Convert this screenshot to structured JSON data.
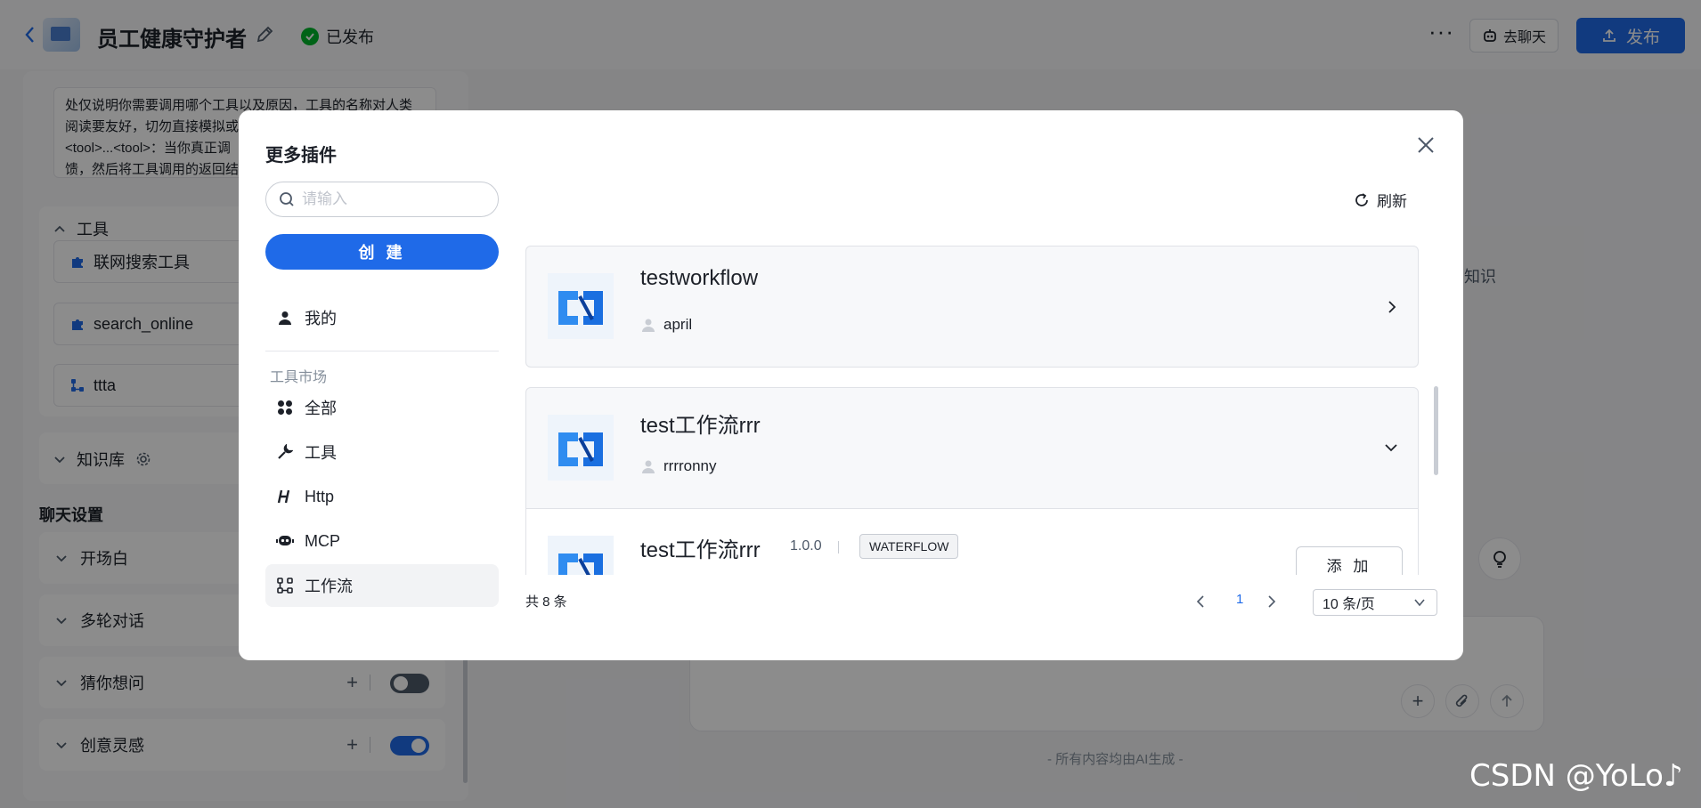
{
  "app": {
    "title": "员工健康守护者",
    "status": "已发布",
    "chat_button": "去聊天",
    "publish_button": "发布"
  },
  "left_panel": {
    "prompt_lines": [
      "处仅说明你需要调用哪个工具以及原因，工具的名称对人类",
      "阅读要友好，切勿直接模拟或",
      "<tool>...<tool>：当你真正调",
      "馈，然后将工具调用的返回结"
    ],
    "tools_section": "工具",
    "tools": [
      "联网搜索工具",
      "search_online",
      "ttta"
    ],
    "knowledge_section": "知识库",
    "chat_settings_title": "聊天设置",
    "settings": [
      {
        "label": "开场白"
      },
      {
        "label": "多轮对话"
      },
      {
        "label": "猜你想问",
        "toggle": false
      },
      {
        "label": "创意灵感",
        "toggle": true
      }
    ]
  },
  "right_area": {
    "knowledge_text": "知识",
    "ai_note": "- 所有内容均由AI生成 -"
  },
  "watermark": "CSDN @YoLo♪",
  "modal": {
    "title": "更多插件",
    "search_placeholder": "请输入",
    "create_button": "创 建",
    "nav_mine": "我的",
    "nav_group": "工具市场",
    "nav_items": [
      "全部",
      "工具",
      "Http",
      "MCP",
      "工作流"
    ],
    "refresh_label": "刷新",
    "cards": [
      {
        "name": "testworkflow",
        "author": "april"
      },
      {
        "name": "test工作流rrr",
        "author": "rrrronny"
      }
    ],
    "sub_item": {
      "name": "test工作流rrr",
      "version": "1.0.0",
      "tag": "WATERFLOW",
      "add_button": "添 加"
    },
    "pagination": {
      "total": "共 8 条",
      "page": "1",
      "page_size": "10 条/页"
    }
  }
}
